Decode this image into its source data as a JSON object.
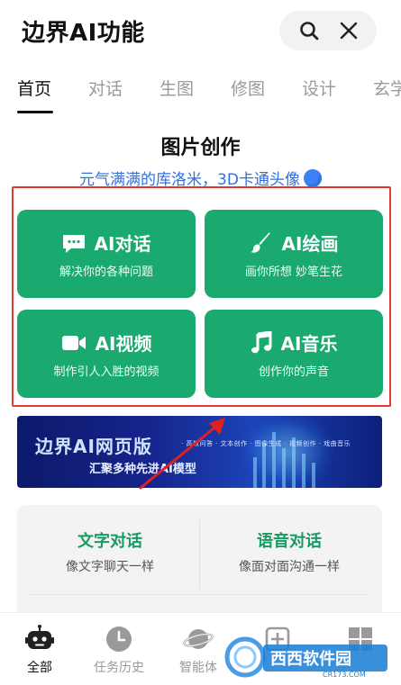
{
  "header": {
    "title": "边界AI功能"
  },
  "tabs": [
    "首页",
    "对话",
    "生图",
    "修图",
    "设计",
    "玄学"
  ],
  "section": {
    "title": "图片创作",
    "subtitle": "元气满满的库洛米，3D卡通头像"
  },
  "features": [
    {
      "title": "AI对话",
      "desc": "解决你的各种问题",
      "icon": "chat-icon"
    },
    {
      "title": "AI绘画",
      "desc": "画你所想 妙笔生花",
      "icon": "brush-icon"
    },
    {
      "title": "AI视频",
      "desc": "制作引人入胜的视频",
      "icon": "video-icon"
    },
    {
      "title": "AI音乐",
      "desc": "创作你的声音",
      "icon": "music-icon"
    }
  ],
  "banner": {
    "title": "边界AI网页版",
    "subtitle": "汇聚多种先进AI模型",
    "features_text": "· 高效问答 · 文本创作 · 图像生成 · 视频创作 · 戏曲音乐"
  },
  "dialog": [
    {
      "title": "文字对话",
      "desc": "像文字聊天一样"
    },
    {
      "title": "语音对话",
      "desc": "像面对面沟通一样"
    }
  ],
  "bottom_nav": [
    {
      "label": "全部",
      "icon": "robot-icon",
      "active": true
    },
    {
      "label": "任务历史",
      "icon": "clock-icon",
      "active": false
    },
    {
      "label": "智能体",
      "icon": "planet-icon",
      "active": false
    },
    {
      "label": "",
      "icon": "add-square-icon",
      "active": false
    },
    {
      "label": "",
      "icon": "grid-icon",
      "active": false
    }
  ],
  "watermark": {
    "brand": "西西软件园",
    "domain": "CR173.COM"
  },
  "colors": {
    "accent_green": "#1aaa70",
    "link_blue": "#2f6fe6",
    "highlight_red": "#e53935"
  }
}
